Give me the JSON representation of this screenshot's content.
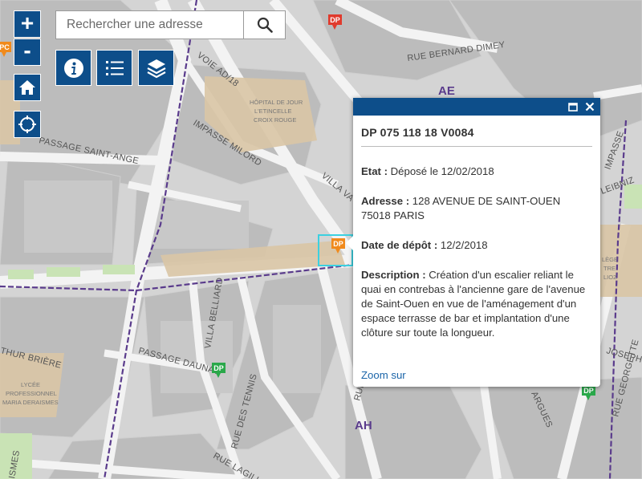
{
  "search": {
    "placeholder": "Rechercher une adresse"
  },
  "controls": {
    "zoom_in": "+",
    "zoom_out": "-"
  },
  "map": {
    "streets": [
      "RUE BERNARD DIMEY",
      "VOIE AD/18",
      "IMPASSE MILORD",
      "PASSAGE SAINT-ANGE",
      "VILLA VA",
      "VILLA BELLIARD",
      "PASSAGE DAUNAY",
      "RUE DES TENNIS",
      "RUE LAGILLE",
      "THUR BRIÈRE",
      "ISMES",
      "IMPASSE",
      "LEIBNIZ",
      "JOSEPH",
      "RUE GEORGETTE",
      "ARGUES",
      "RUE F"
    ],
    "poi_labels": {
      "hopital": [
        "HÔPITAL DE JOUR",
        "L'ETINCELLE",
        "CROIX ROUGE"
      ],
      "lycee": [
        "LYCÉE",
        "PROFESSIONNEL",
        "MARIA DERAISMES"
      ],
      "college": [
        "LÈGE",
        "TRE",
        "LIOZ"
      ]
    },
    "zone_labels": [
      "AE",
      "AH"
    ],
    "markers": [
      {
        "label": "DP",
        "color": "#e03a2c"
      },
      {
        "label": "DP",
        "color": "#f08a1c"
      },
      {
        "label": "DP",
        "color": "#2aa84a"
      },
      {
        "label": "DP",
        "color": "#2aa84a"
      },
      {
        "label": "PC",
        "color": "#f08a1c"
      }
    ]
  },
  "popup": {
    "title": "DP 075 118 18 V0084",
    "etat_label": "Etat :",
    "etat_value": "Déposé le 12/02/2018",
    "adresse_label": "Adresse :",
    "adresse_value": "128 AVENUE DE SAINT-OUEN 75018 PARIS",
    "date_label": "Date de dépôt :",
    "date_value": "12/2/2018",
    "description_label": "Description :",
    "description_value": "Création d'un escalier reliant le quai en contrebas à l'ancienne gare de l'avenue de Saint-Ouen en vue de l'aménagement d'un espace terrasse de bar et implantation d'une clôture sur toute la longueur.",
    "zoom_link": "Zoom sur"
  },
  "colors": {
    "primary": "#0d4e8a",
    "background_block": "#bdbdbd",
    "road": "#f2f2f2",
    "highlight_building": "#d9c5a5",
    "boundary": "#5a3b8c",
    "selection": "#3cd0e0"
  }
}
